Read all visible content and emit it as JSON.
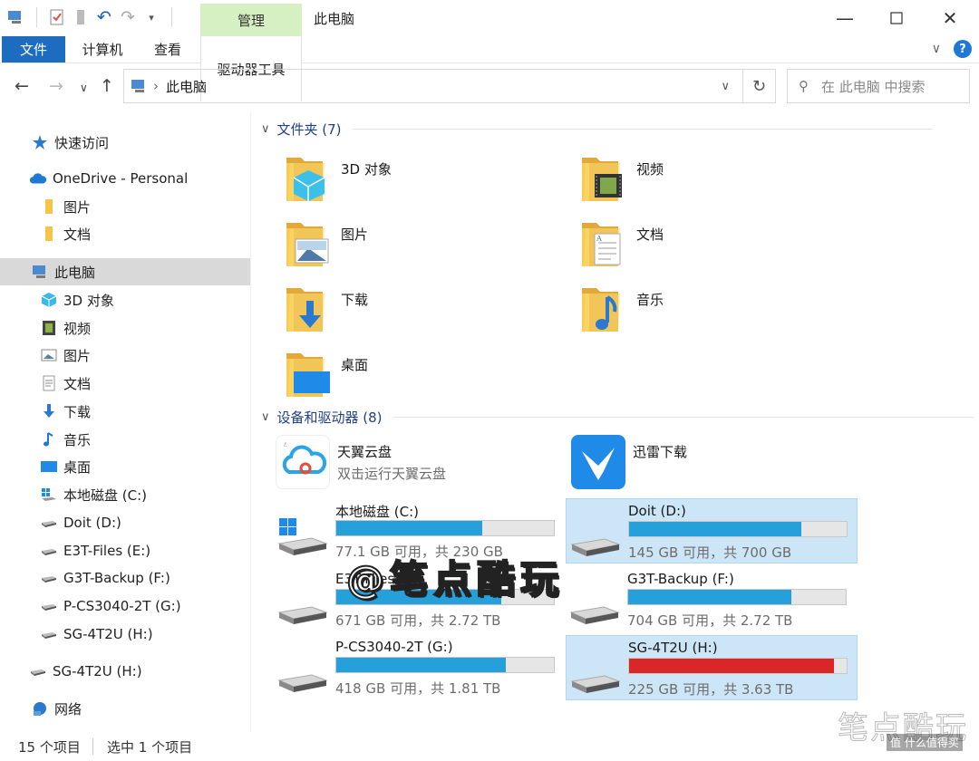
{
  "window": {
    "title": "此电脑",
    "manage_tab": "管理",
    "ribbon_tabs": [
      "文件",
      "计算机",
      "查看",
      "驱动器工具"
    ]
  },
  "address": {
    "path": "此电脑",
    "search_placeholder": "在 此电脑 中搜索"
  },
  "sidebar": {
    "items": [
      {
        "label": "快速访问",
        "icon": "star-icon"
      },
      {
        "label": "OneDrive - Personal",
        "icon": "cloud-icon"
      },
      {
        "label": "图片",
        "icon": "folder-icon"
      },
      {
        "label": "文档",
        "icon": "folder-icon"
      },
      {
        "label": "此电脑",
        "icon": "computer-icon"
      },
      {
        "label": "3D 对象",
        "icon": "cube-icon"
      },
      {
        "label": "视频",
        "icon": "video-icon"
      },
      {
        "label": "图片",
        "icon": "picture-icon"
      },
      {
        "label": "文档",
        "icon": "document-icon"
      },
      {
        "label": "下载",
        "icon": "download-icon"
      },
      {
        "label": "音乐",
        "icon": "music-icon"
      },
      {
        "label": "桌面",
        "icon": "desktop-icon"
      },
      {
        "label": "本地磁盘 (C:)",
        "icon": "windows-drive-icon"
      },
      {
        "label": "Doit (D:)",
        "icon": "drive-icon"
      },
      {
        "label": "E3T-Files (E:)",
        "icon": "drive-icon"
      },
      {
        "label": "G3T-Backup (F:)",
        "icon": "drive-icon"
      },
      {
        "label": "P-CS3040-2T (G:)",
        "icon": "drive-icon"
      },
      {
        "label": "SG-4T2U (H:)",
        "icon": "drive-icon"
      },
      {
        "label": "SG-4T2U (H:)",
        "icon": "drive-icon"
      },
      {
        "label": "网络",
        "icon": "network-icon"
      }
    ]
  },
  "folders": {
    "header": "文件夹 (7)",
    "items": [
      {
        "label": "3D 对象",
        "icon": "cube-folder-icon"
      },
      {
        "label": "视频",
        "icon": "video-folder-icon"
      },
      {
        "label": "图片",
        "icon": "picture-folder-icon"
      },
      {
        "label": "文档",
        "icon": "document-folder-icon"
      },
      {
        "label": "下载",
        "icon": "download-folder-icon"
      },
      {
        "label": "音乐",
        "icon": "music-folder-icon"
      },
      {
        "label": "桌面",
        "icon": "desktop-folder-icon"
      }
    ]
  },
  "devices": {
    "header": "设备和驱动器 (8)",
    "apps": [
      {
        "name": "天翼云盘",
        "desc": "双击运行天翼云盘",
        "icon": "tianyi-cloud-icon"
      },
      {
        "name": "迅雷下载",
        "desc": "",
        "icon": "xunlei-icon"
      }
    ],
    "drives": [
      {
        "name": "本地磁盘 (C:)",
        "size": "77.1 GB 可用，共 230 GB",
        "used_fraction": 0.67,
        "color": "#26a0da"
      },
      {
        "name": "Doit (D:)",
        "size": "145 GB 可用，共 700 GB",
        "used_fraction": 0.79,
        "color": "#26a0da"
      },
      {
        "name": "E3T-Files (E:)",
        "size": "671 GB 可用，共 2.72 TB",
        "used_fraction": 0.76,
        "color": "#26a0da"
      },
      {
        "name": "G3T-Backup (F:)",
        "size": "704 GB 可用，共 2.72 TB",
        "used_fraction": 0.75,
        "color": "#26a0da"
      },
      {
        "name": "P-CS3040-2T (G:)",
        "size": "418 GB 可用，共 1.81 TB",
        "used_fraction": 0.78,
        "color": "#26a0da"
      },
      {
        "name": "SG-4T2U (H:)",
        "size": "225 GB 可用，共 3.63 TB",
        "used_fraction": 0.94,
        "color": "#da2626"
      }
    ]
  },
  "status": {
    "count": "15 个项目",
    "selected": "选中 1 个项目"
  },
  "watermark": {
    "center": "@笔点酷玩",
    "corner": "笔点酷玩",
    "corner_small": "值 什么值得买"
  }
}
